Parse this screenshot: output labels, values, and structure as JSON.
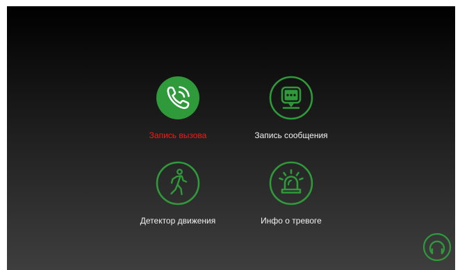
{
  "menu": {
    "items": [
      {
        "label": "Запись вызова",
        "icon": "phone-call-icon",
        "selected": true
      },
      {
        "label": "Запись сообщения",
        "icon": "message-bubble-icon",
        "selected": false
      },
      {
        "label": "Детектор движения",
        "icon": "walking-person-icon",
        "selected": false
      },
      {
        "label": "Инфо о тревоге",
        "icon": "alarm-siren-icon",
        "selected": false
      }
    ]
  },
  "navigation": {
    "icon": "home-return-icon"
  },
  "colors": {
    "accent": "#2f9a3a",
    "selected_fill": "#2f9a3a",
    "selected_label": "#ff1616",
    "label": "#f2f2f2"
  }
}
